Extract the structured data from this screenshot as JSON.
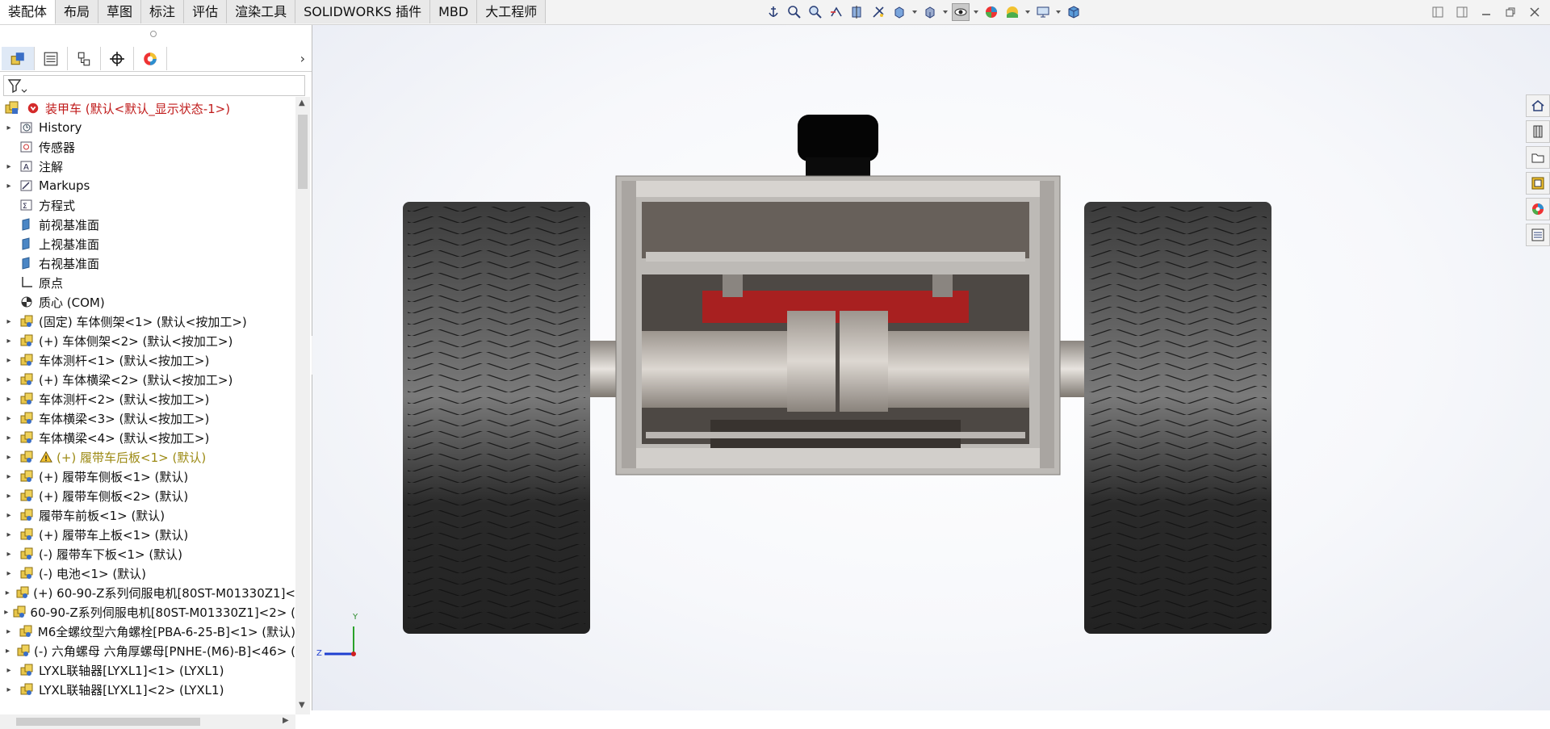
{
  "tabs": [
    "装配体",
    "布局",
    "草图",
    "标注",
    "评估",
    "渲染工具",
    "SOLIDWORKS 插件",
    "MBD",
    "大工程师"
  ],
  "active_tab": "装配体",
  "toolbar_icons": [
    "anchor-icon",
    "zoom-fit-icon",
    "zoom-area-icon",
    "previous-view-icon",
    "section-view-icon",
    "dynamic-annotation-icon",
    "view-orientation-icon",
    "display-style-icon",
    "hide-show-icon",
    "edit-appearance-icon",
    "apply-scene-icon",
    "view-settings-icon",
    "3d-cube-icon"
  ],
  "window_controls": [
    "restore-left-icon",
    "restore-right-icon",
    "minimize-icon",
    "maximize-icon",
    "close-icon"
  ],
  "panel_tabs": [
    "featuremanager-icon",
    "propertymanager-icon",
    "configuration-icon",
    "dimxpert-icon",
    "display-manager-icon"
  ],
  "tree": {
    "root": "装甲车  (默认<默认_显示状态-1>)",
    "items": [
      {
        "label": "History",
        "expand": true,
        "icon": "history-icon",
        "color": "normal"
      },
      {
        "label": "传感器",
        "expand": false,
        "icon": "sensor-icon",
        "color": "normal"
      },
      {
        "label": "注解",
        "expand": true,
        "icon": "annotation-icon",
        "color": "normal"
      },
      {
        "label": "Markups",
        "expand": true,
        "icon": "markup-icon",
        "color": "normal"
      },
      {
        "label": "方程式",
        "expand": false,
        "icon": "equation-icon",
        "color": "normal"
      },
      {
        "label": "前视基准面",
        "expand": false,
        "icon": "plane-icon",
        "color": "normal"
      },
      {
        "label": "上视基准面",
        "expand": false,
        "icon": "plane-icon",
        "color": "normal"
      },
      {
        "label": "右视基准面",
        "expand": false,
        "icon": "plane-icon",
        "color": "normal"
      },
      {
        "label": "原点",
        "expand": false,
        "icon": "origin-icon",
        "color": "normal"
      },
      {
        "label": "质心 (COM)",
        "expand": false,
        "icon": "center-of-mass-icon",
        "color": "normal"
      },
      {
        "label": "(固定) 车体侧架<1> (默认<按加工>)",
        "expand": true,
        "icon": "subassembly-icon",
        "color": "normal"
      },
      {
        "label": "(+) 车体侧架<2> (默认<按加工>)",
        "expand": true,
        "icon": "subassembly-icon",
        "color": "normal"
      },
      {
        "label": "车体测杆<1> (默认<按加工>)",
        "expand": true,
        "icon": "subassembly-icon",
        "color": "normal"
      },
      {
        "label": "(+) 车体横梁<2> (默认<按加工>)",
        "expand": true,
        "icon": "subassembly-icon",
        "color": "normal"
      },
      {
        "label": "车体测杆<2> (默认<按加工>)",
        "expand": true,
        "icon": "subassembly-icon",
        "color": "normal"
      },
      {
        "label": "车体横梁<3> (默认<按加工>)",
        "expand": true,
        "icon": "subassembly-icon",
        "color": "normal"
      },
      {
        "label": "车体横梁<4> (默认<按加工>)",
        "expand": true,
        "icon": "subassembly-icon",
        "color": "normal"
      },
      {
        "label": "(+) 履带车后板<1> (默认)",
        "expand": true,
        "icon": "subassembly-icon",
        "color": "olive",
        "warning": true
      },
      {
        "label": "(+) 履带车侧板<1> (默认)",
        "expand": true,
        "icon": "subassembly-icon",
        "color": "normal"
      },
      {
        "label": "(+) 履带车侧板<2> (默认)",
        "expand": true,
        "icon": "subassembly-icon",
        "color": "normal"
      },
      {
        "label": "履带车前板<1> (默认)",
        "expand": true,
        "icon": "subassembly-icon",
        "color": "normal"
      },
      {
        "label": "(+) 履带车上板<1> (默认)",
        "expand": true,
        "icon": "subassembly-icon",
        "color": "normal"
      },
      {
        "label": "(-) 履带车下板<1> (默认)",
        "expand": true,
        "icon": "subassembly-icon",
        "color": "normal"
      },
      {
        "label": "(-) 电池<1> (默认)",
        "expand": true,
        "icon": "subassembly-icon",
        "color": "normal"
      },
      {
        "label": "(+) 60-90-Z系列伺服电机[80ST-M01330Z1]<",
        "expand": true,
        "icon": "subassembly-icon",
        "color": "normal"
      },
      {
        "label": "60-90-Z系列伺服电机[80ST-M01330Z1]<2> (",
        "expand": true,
        "icon": "subassembly-icon",
        "color": "normal"
      },
      {
        "label": "M6全螺纹型六角螺栓[PBA-6-25-B]<1> (默认)",
        "expand": true,
        "icon": "subassembly-icon",
        "color": "normal"
      },
      {
        "label": "(-) 六角螺母 六角厚螺母[PNHE-(M6)-B]<46> (",
        "expand": true,
        "icon": "subassembly-icon",
        "color": "normal"
      },
      {
        "label": "LYXL联轴器[LYXL1]<1> (LYXL1)",
        "expand": true,
        "icon": "subassembly-icon",
        "color": "normal"
      },
      {
        "label": "LYXL联轴器[LYXL1]<2> (LYXL1)",
        "expand": true,
        "icon": "subassembly-icon",
        "color": "normal"
      }
    ]
  },
  "axis_triad": {
    "y": "Y",
    "z": "Z"
  },
  "right_taskpane_icons": [
    "home-icon",
    "design-library-icon",
    "file-explorer-icon",
    "view-palette-icon",
    "appearances-icon",
    "custom-properties-icon"
  ],
  "colors": {
    "accent_blue": "#1f5fbf",
    "tree_red": "#c01b1b",
    "warning_olive": "#9c8a14",
    "frame_red": "#a82020"
  }
}
